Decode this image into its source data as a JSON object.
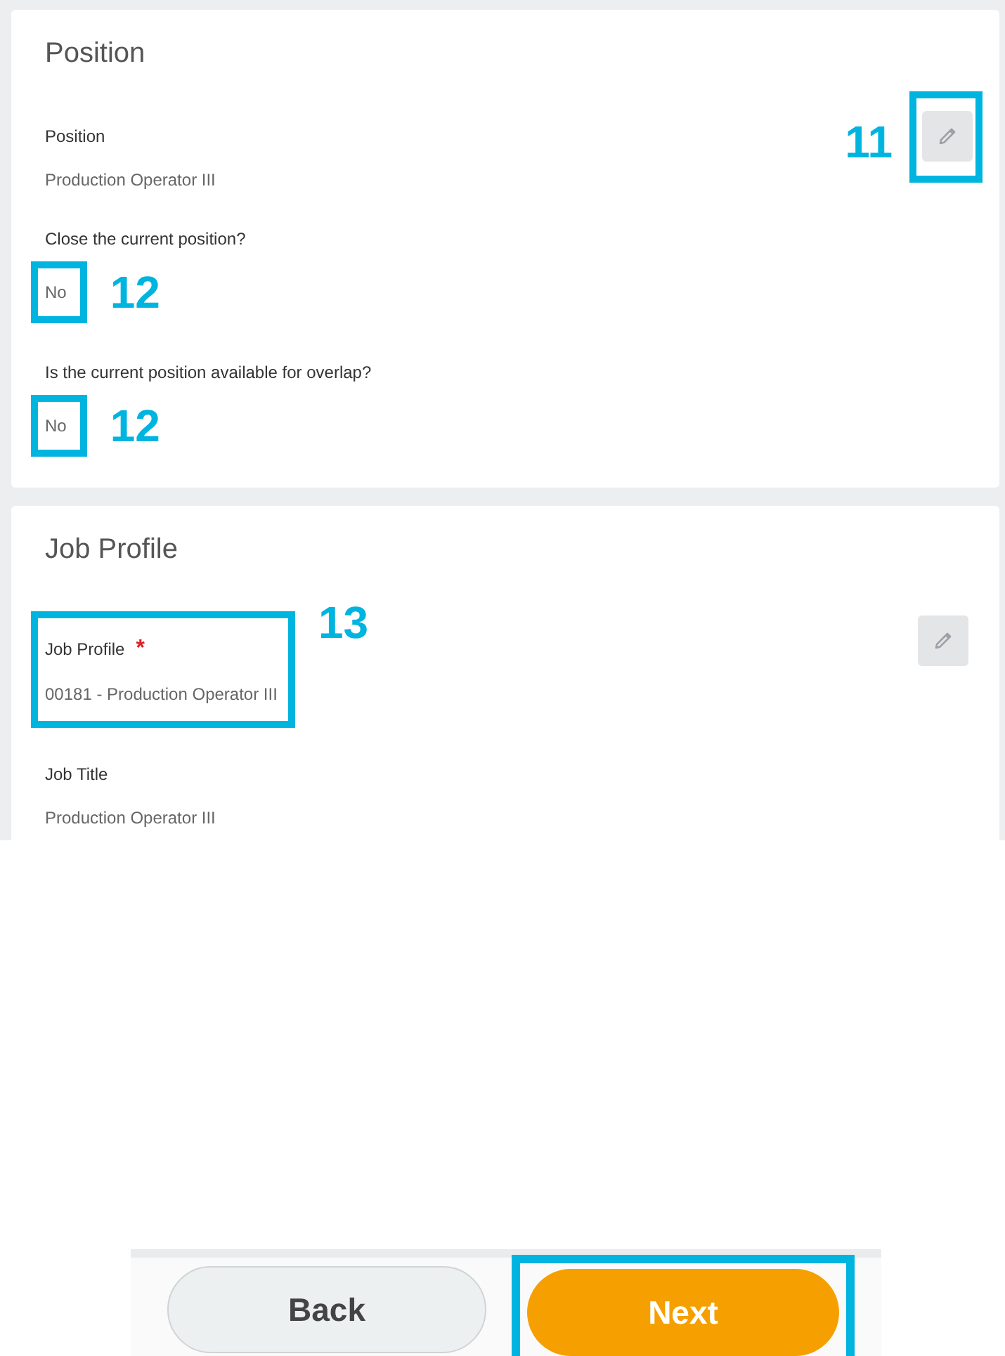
{
  "sections": [
    {
      "title": "Position",
      "edit_callout": "11",
      "fields": [
        {
          "label": "Position",
          "value": "Production Operator III",
          "required": false
        },
        {
          "label": "Close the current position?",
          "value": "No",
          "required": false,
          "kind": "value-callout",
          "callout": "12"
        },
        {
          "label": "Is the current position available for overlap?",
          "value": "No",
          "required": false,
          "kind": "value-callout",
          "callout": "12"
        }
      ]
    },
    {
      "title": "Job Profile",
      "fields": [
        {
          "label": "Job Profile",
          "value": "00181 - Production Operator III",
          "required": true,
          "kind": "field-callout",
          "callout": "13"
        },
        {
          "label": "Job Title",
          "value": "Production Operator III",
          "required": false
        }
      ]
    }
  ],
  "required_mark": "*",
  "buttons": [
    {
      "label": "Back",
      "kind": "secondary"
    },
    {
      "label": "Next",
      "kind": "primary",
      "callout": true
    }
  ]
}
